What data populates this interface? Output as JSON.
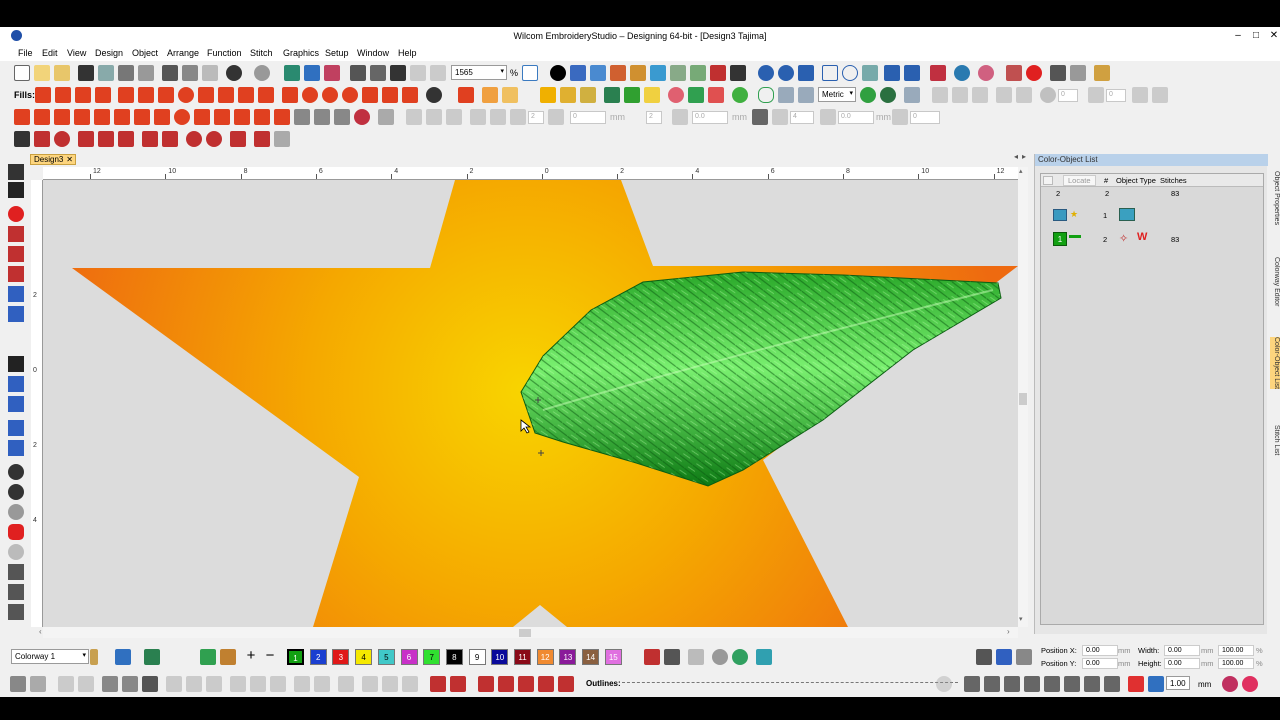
{
  "window": {
    "title": "Wilcom EmbroideryStudio – Designing 64-bit - [Design3       Tajima]",
    "controls": {
      "minimize": "–",
      "maximize": "□",
      "close": "✕"
    }
  },
  "menu": [
    "File",
    "Edit",
    "View",
    "Design",
    "Object",
    "Arrange",
    "Function",
    "Stitch",
    "Graphics",
    "Setup",
    "Window",
    "Help"
  ],
  "toolbar": {
    "zoom_value": "1565",
    "zoom_unit": "%",
    "fills_label": "Fills:",
    "unit_select": "Metric",
    "spin_values": [
      "0",
      "0",
      "2",
      "0",
      "2",
      "0.0",
      "4",
      "0.0",
      "0",
      "2",
      "0"
    ],
    "spin_units": [
      "mm",
      "mm",
      "mm"
    ]
  },
  "document_tab": {
    "label": "Design3",
    "close": "✕"
  },
  "ruler": {
    "h_labels": [
      "12",
      "10",
      "8",
      "6",
      "4",
      "2",
      "0",
      "2",
      "4",
      "6",
      "8",
      "10",
      "12"
    ],
    "v_labels": [
      "2",
      "0",
      "2",
      "4"
    ]
  },
  "color_object_list": {
    "title": "Color-Object List",
    "locate": "Locate",
    "headers": {
      "count": "#",
      "type": "Object Type",
      "stitches": "Stitches"
    },
    "summary": {
      "a": "2",
      "b": "2",
      "stitches": "83"
    },
    "rows": [
      {
        "index": "1",
        "stitches": "",
        "type_icon": "picture-icon"
      },
      {
        "index": "2",
        "stitches": "83",
        "type_icon": "satin-stitch-icon",
        "color_number": "1"
      }
    ]
  },
  "side_tabs": [
    "Object Properties",
    "Colorway Editor",
    "Color-Object List",
    "Stitch List"
  ],
  "colorway": {
    "select": "Colorway 1",
    "swatches": [
      {
        "n": "1",
        "color": "#12a012"
      },
      {
        "n": "2",
        "color": "#1a3fd0"
      },
      {
        "n": "3",
        "color": "#e01818"
      },
      {
        "n": "4",
        "color": "#f5e800"
      },
      {
        "n": "5",
        "color": "#40c8c8"
      },
      {
        "n": "6",
        "color": "#c830c8"
      },
      {
        "n": "7",
        "color": "#30e030"
      },
      {
        "n": "8",
        "color": "#000000"
      },
      {
        "n": "9",
        "color": "#ffffff"
      },
      {
        "n": "10",
        "color": "#0a0a9a"
      },
      {
        "n": "11",
        "color": "#8a0a18"
      },
      {
        "n": "12",
        "color": "#f08a30"
      },
      {
        "n": "13",
        "color": "#8a1a9a"
      },
      {
        "n": "14",
        "color": "#8a6040"
      },
      {
        "n": "15",
        "color": "#e070e0"
      }
    ]
  },
  "outlines_label": "Outlines:",
  "position": {
    "x_label": "Position X:",
    "x": "0.00",
    "y_label": "Position Y:",
    "y": "0.00",
    "w_label": "Width:",
    "w": "0.00",
    "h_label": "Height:",
    "h": "0.00",
    "unit": "mm",
    "pct1": "100.00",
    "pct2": "100.00",
    "pct_unit": "%"
  },
  "line_width": "1.00",
  "line_width_unit": "mm"
}
